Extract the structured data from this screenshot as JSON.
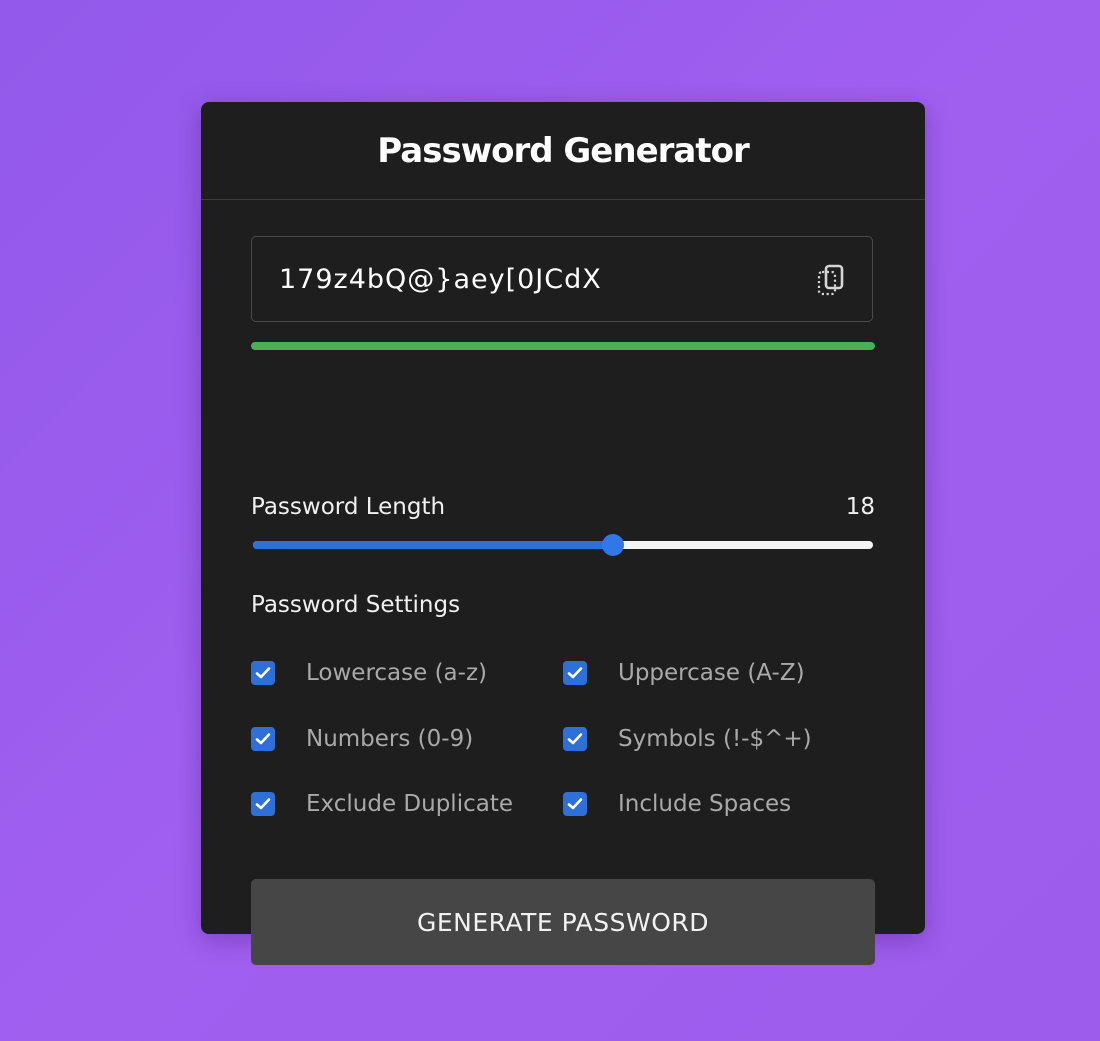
{
  "header": {
    "title": "Password Generator"
  },
  "password": {
    "value": "179z4bQ@}aey[0JCdX",
    "copy_icon": "copy-icon",
    "strength_fraction": 1.0,
    "strength_color": "#4cae5a"
  },
  "length": {
    "label": "Password Length",
    "value": "18",
    "slider_fraction": 0.58,
    "fill_color": "#2f6fd8"
  },
  "settings": {
    "label": "Password Settings",
    "options": [
      {
        "label": "Lowercase (a-z)",
        "checked": true
      },
      {
        "label": "Uppercase (A-Z)",
        "checked": true
      },
      {
        "label": "Numbers (0-9)",
        "checked": true
      },
      {
        "label": "Symbols (!-$^+)",
        "checked": true
      },
      {
        "label": "Exclude Duplicate",
        "checked": true
      },
      {
        "label": "Include Spaces",
        "checked": true
      }
    ]
  },
  "actions": {
    "generate_label": "GENERATE PASSWORD"
  },
  "colors": {
    "background": "#9b5cee",
    "card": "#1e1e1e",
    "accent": "#2f6fd8",
    "button": "#464646"
  }
}
